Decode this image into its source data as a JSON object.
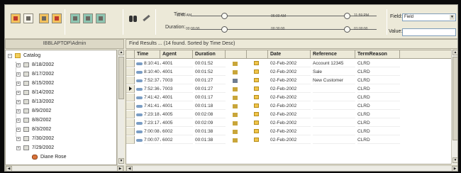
{
  "toolbar": {
    "time_label": "Time:",
    "duration_label": "Duration:",
    "time_start": "12:00 AM",
    "time_mid": "06:00 AM",
    "time_end": "11:59 PM",
    "duration_start": "00:00:00",
    "duration_mid": "00:30:00",
    "duration_end": "01:00:00",
    "field_label": "Field:",
    "field_value": "Field",
    "value_label": "Value:",
    "value_input": ""
  },
  "left_panel": {
    "user": "IBBLAPTOP\\Admin",
    "tree": [
      {
        "label": "Catalog",
        "depth": 0,
        "icon": "folder-icon"
      },
      {
        "label": "8/18/2002",
        "depth": 1,
        "icon": "calendar-icon"
      },
      {
        "label": "8/17/2002",
        "depth": 1,
        "icon": "calendar-icon"
      },
      {
        "label": "8/15/2002",
        "depth": 1,
        "icon": "calendar-icon"
      },
      {
        "label": "8/14/2002",
        "depth": 1,
        "icon": "calendar-icon"
      },
      {
        "label": "8/13/2002",
        "depth": 1,
        "icon": "calendar-icon"
      },
      {
        "label": "8/9/2002",
        "depth": 1,
        "icon": "calendar-icon"
      },
      {
        "label": "8/8/2002",
        "depth": 1,
        "icon": "calendar-icon"
      },
      {
        "label": "8/3/2002",
        "depth": 1,
        "icon": "calendar-icon"
      },
      {
        "label": "7/30/2002",
        "depth": 1,
        "icon": "calendar-icon"
      },
      {
        "label": "7/29/2002",
        "depth": 1,
        "icon": "calendar-icon"
      },
      {
        "label": "Diane Rose",
        "depth": 2,
        "icon": "person-icon"
      }
    ]
  },
  "results": {
    "summary": "Find Results ... (14 found. Sorted by Time Desc)",
    "columns": [
      "Time",
      "Agent",
      "Duration",
      "",
      "",
      "Date",
      "Reference",
      "TermReason"
    ],
    "rows": [
      {
        "time": "8:10:41 AM",
        "agent": "4001",
        "duration": "00:01:52",
        "speaker": "normal",
        "date": "02-Feb-2002",
        "reference": "Account 12345",
        "term": "CLRD"
      },
      {
        "time": "8:10:40 AM",
        "agent": "4001",
        "duration": "00:01:52",
        "speaker": "normal",
        "date": "02-Feb-2002",
        "reference": "Sale",
        "term": "CLRD"
      },
      {
        "time": "7:52:37 AM",
        "agent": "7003",
        "duration": "00:01:27",
        "speaker": "ok",
        "date": "02-Feb-2002",
        "reference": "New Customer",
        "term": "CLRD"
      },
      {
        "time": "7:52:36 AM",
        "agent": "7003",
        "duration": "00:01:27",
        "speaker": "normal",
        "date": "02-Feb-2002",
        "reference": "",
        "term": "CLRD"
      },
      {
        "time": "7:41:42 AM",
        "agent": "4001",
        "duration": "00:01:17",
        "speaker": "normal",
        "date": "02-Feb-2002",
        "reference": "",
        "term": "CLRD"
      },
      {
        "time": "7:41:41 AM",
        "agent": "4001",
        "duration": "00:01:18",
        "speaker": "normal",
        "date": "02-Feb-2002",
        "reference": "",
        "term": "CLRD"
      },
      {
        "time": "7:23:18 AM",
        "agent": "4005",
        "duration": "00:02:08",
        "speaker": "normal",
        "date": "02-Feb-2002",
        "reference": "",
        "term": "CLRD"
      },
      {
        "time": "7:23:17 AM",
        "agent": "4005",
        "duration": "00:02:09",
        "speaker": "normal",
        "date": "02-Feb-2002",
        "reference": "",
        "term": "CLRD"
      },
      {
        "time": "7:00:08 AM",
        "agent": "6002",
        "duration": "00:01:38",
        "speaker": "normal",
        "date": "02-Feb-2002",
        "reference": "",
        "term": "CLRD"
      },
      {
        "time": "7:00:07 AM",
        "agent": "6002",
        "duration": "00:01:38",
        "speaker": "normal",
        "date": "02-Feb-2002",
        "reference": "",
        "term": "CLRD"
      }
    ],
    "active_row_index": 3
  }
}
